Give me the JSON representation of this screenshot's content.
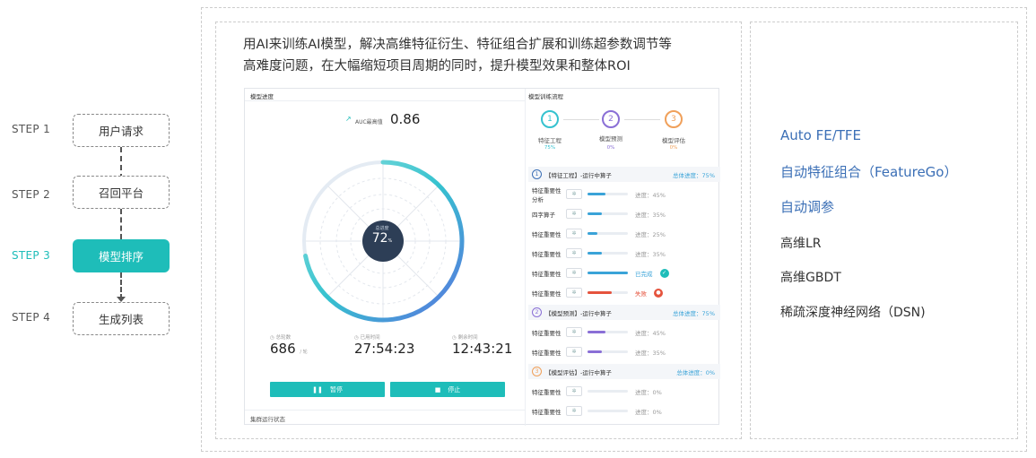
{
  "steps": [
    {
      "label": "STEP 1",
      "box": "用户请求"
    },
    {
      "label": "STEP 2",
      "box": "召回平台"
    },
    {
      "label": "STEP 3",
      "box": "模型排序"
    },
    {
      "label": "STEP 4",
      "box": "生成列表"
    }
  ],
  "intro": {
    "line1": "用AI来训练AI模型，解决高维特征衍生、特征组合扩展和训练超参数调节等",
    "line2": "高难度问题，在大幅缩短项目周期的同时，提升模型效果和整体ROI"
  },
  "dashboard": {
    "progress_title": "模型进度",
    "auc_label": "AUC最高值",
    "auc_value": "0.86",
    "center_label": "总进度",
    "center_value": "72",
    "center_unit": "%",
    "center_progress": 0.72,
    "stats": [
      {
        "label": "总轮数",
        "value": "686",
        "unit": "/ 轮"
      },
      {
        "label": "已用时间",
        "value": "27:54:23",
        "unit": ""
      },
      {
        "label": "剩余时间",
        "value": "12:43:21",
        "unit": ""
      }
    ],
    "pause_label": "暂停",
    "stop_label": "停止",
    "cluster_label": "集群运行状态",
    "flow_title": "模型训练流程",
    "flow_steps": [
      {
        "num": "1",
        "name": "特征工程",
        "pct": "75%"
      },
      {
        "num": "2",
        "name": "模型预测",
        "pct": "0%"
      },
      {
        "num": "3",
        "name": "模型评估",
        "pct": "0%"
      }
    ],
    "sections": [
      {
        "num": "1",
        "title": "【特征工程】-运行中算子",
        "total": "总体进度：75%",
        "rows": [
          {
            "name": "特征重要性分析",
            "status": "进度：45%",
            "fill": 0.45
          },
          {
            "name": "四字算子",
            "status": "进度：35%",
            "fill": 0.35
          },
          {
            "name": "特征重要性",
            "status": "进度：25%",
            "fill": 0.25
          },
          {
            "name": "特征重要性",
            "status": "进度：35%",
            "fill": 0.35
          },
          {
            "name": "特征重要性",
            "status": "已完成",
            "fill": 1.0
          },
          {
            "name": "特征重要性",
            "status": "失败",
            "fill": 0.6
          }
        ]
      },
      {
        "num": "2",
        "title": "【模型预测】-运行中算子",
        "total": "总体进度：75%",
        "rows": [
          {
            "name": "特征重要性",
            "status": "进度：45%",
            "fill": 0.45
          },
          {
            "name": "特征重要性",
            "status": "进度：35%",
            "fill": 0.35
          }
        ]
      },
      {
        "num": "3",
        "title": "【模型评估】-运行中算子",
        "total": "总体进度：0%",
        "rows": [
          {
            "name": "特征重要性",
            "status": "进度：0%",
            "fill": 0.0
          },
          {
            "name": "特征重要性",
            "status": "进度：0%",
            "fill": 0.0
          }
        ]
      }
    ]
  },
  "right_list": [
    "Auto FE/TFE",
    "自动特征组合（FeatureGo）",
    "自动调参",
    "高维LR",
    "高维GBDT",
    "稀疏深度神经网络（DSN)"
  ],
  "colors": {
    "accent": "#1ebdb9",
    "blue": "#3b6fb6",
    "purple": "#8a6fd6",
    "orange": "#f0a05a",
    "red": "#e5533d"
  }
}
